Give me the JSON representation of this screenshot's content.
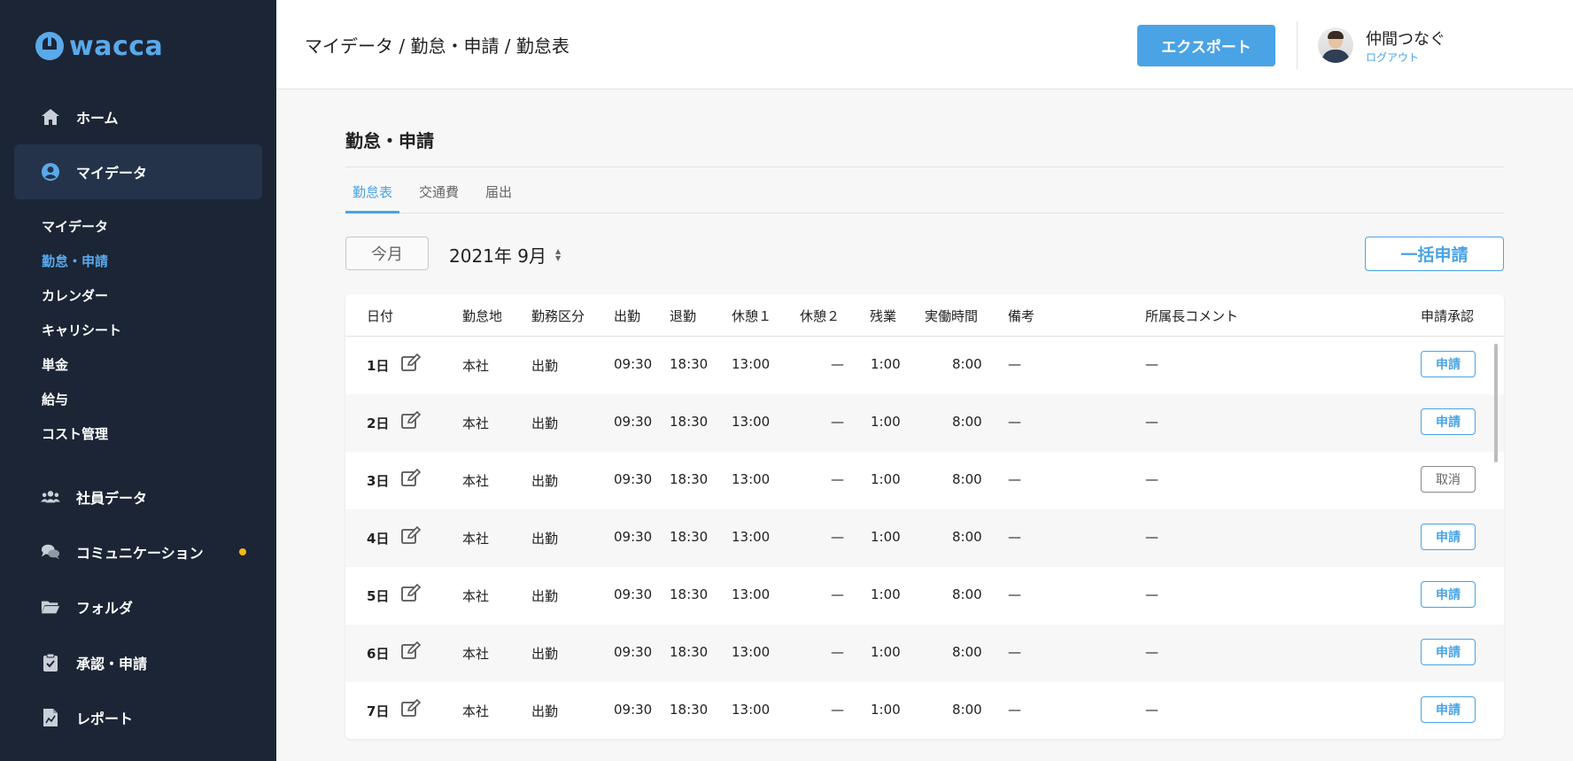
{
  "app": {
    "logo_text": "wacca",
    "brand_color": "#4aa3e4",
    "sidebar_bg": "#1b2535"
  },
  "sidebar": {
    "nav_top": [
      {
        "label": "ホーム",
        "icon": "home-icon"
      },
      {
        "label": "マイデータ",
        "icon": "user-circle-icon",
        "active": true
      }
    ],
    "subnav": [
      {
        "label": "マイデータ"
      },
      {
        "label": "勤怠・申請",
        "active": true
      },
      {
        "label": "カレンダー"
      },
      {
        "label": "キャリシート"
      },
      {
        "label": "単金"
      },
      {
        "label": "給与"
      },
      {
        "label": "コスト管理"
      }
    ],
    "nav_bottom": [
      {
        "label": "社員データ",
        "icon": "users-icon"
      },
      {
        "label": "コミュニケーション",
        "icon": "chat-icon",
        "notification": true
      },
      {
        "label": "フォルダ",
        "icon": "folder-icon"
      },
      {
        "label": "承認・申請",
        "icon": "clipboard-check-icon"
      },
      {
        "label": "レポート",
        "icon": "report-icon"
      }
    ]
  },
  "header": {
    "breadcrumb": "マイデータ / 勤怠・申請 / 勤怠表",
    "export_label": "エクスポート",
    "user_name": "仲間つなぐ",
    "logout_label": "ログアウト"
  },
  "main": {
    "title": "勤怠・申請",
    "tabs": [
      {
        "label": "勤怠表",
        "active": true
      },
      {
        "label": "交通費"
      },
      {
        "label": "届出"
      }
    ],
    "this_month_label": "今月",
    "month": "2021年 9月",
    "bulk_apply_label": "一括申請"
  },
  "table": {
    "columns": [
      "日付",
      "勤怠地",
      "勤務区分",
      "出勤",
      "退勤",
      "休憩１",
      "休憩２",
      "残業",
      "実働時間",
      "備考",
      "所属長コメント",
      "申請承認"
    ],
    "rows": [
      {
        "day": "1日",
        "place": "本社",
        "type": "出勤",
        "in": "09:30",
        "out": "18:30",
        "break1": "13:00",
        "break2": "—",
        "overtime": "1:00",
        "worked": "8:00",
        "note": "—",
        "comment": "—",
        "action": "申請"
      },
      {
        "day": "2日",
        "place": "本社",
        "type": "出勤",
        "in": "09:30",
        "out": "18:30",
        "break1": "13:00",
        "break2": "—",
        "overtime": "1:00",
        "worked": "8:00",
        "note": "—",
        "comment": "—",
        "action": "申請"
      },
      {
        "day": "3日",
        "place": "本社",
        "type": "出勤",
        "in": "09:30",
        "out": "18:30",
        "break1": "13:00",
        "break2": "—",
        "overtime": "1:00",
        "worked": "8:00",
        "note": "—",
        "comment": "—",
        "action": "取消"
      },
      {
        "day": "4日",
        "place": "本社",
        "type": "出勤",
        "in": "09:30",
        "out": "18:30",
        "break1": "13:00",
        "break2": "—",
        "overtime": "1:00",
        "worked": "8:00",
        "note": "—",
        "comment": "—",
        "action": "申請"
      },
      {
        "day": "5日",
        "place": "本社",
        "type": "出勤",
        "in": "09:30",
        "out": "18:30",
        "break1": "13:00",
        "break2": "—",
        "overtime": "1:00",
        "worked": "8:00",
        "note": "—",
        "comment": "—",
        "action": "申請"
      },
      {
        "day": "6日",
        "place": "本社",
        "type": "出勤",
        "in": "09:30",
        "out": "18:30",
        "break1": "13:00",
        "break2": "—",
        "overtime": "1:00",
        "worked": "8:00",
        "note": "—",
        "comment": "—",
        "action": "申請"
      },
      {
        "day": "7日",
        "place": "本社",
        "type": "出勤",
        "in": "09:30",
        "out": "18:30",
        "break1": "13:00",
        "break2": "—",
        "overtime": "1:00",
        "worked": "8:00",
        "note": "—",
        "comment": "—",
        "action": "申請"
      }
    ]
  }
}
